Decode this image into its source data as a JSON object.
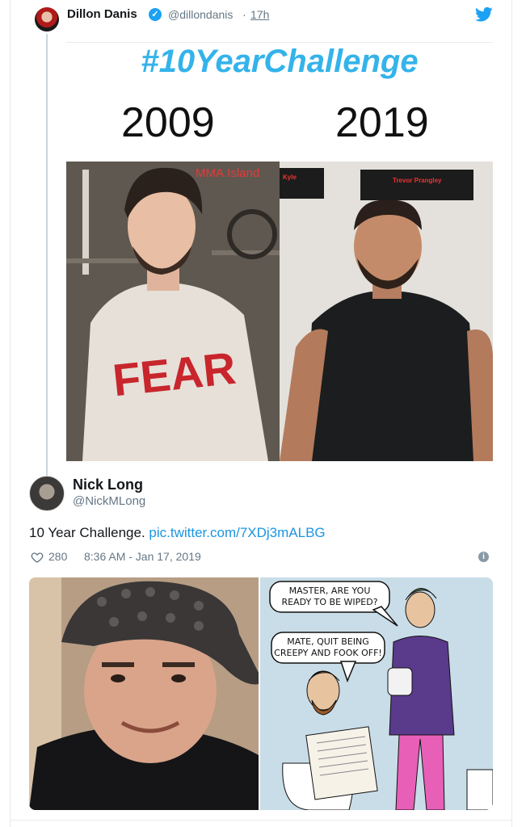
{
  "tweet1": {
    "name": "Dillon Danis",
    "handle": "@dillondanis",
    "separator": "·",
    "time": "17h",
    "image": {
      "title": "#10YearChallenge",
      "year_left": "2009",
      "year_right": "2019",
      "watermark": "MMA.Island",
      "shirt_text": "FEAR",
      "sign_left": "Kyle",
      "sign_right": "Trevor Prangley"
    }
  },
  "tweet2": {
    "name": "Nick Long",
    "handle": "@NickMLong",
    "text": "10 Year Challenge. ",
    "link": "pic.twitter.com/7XDj3mALBG",
    "likes": "280",
    "datetime": "8:36 AM - Jan 17, 2019",
    "cartoon": {
      "bubble1_line1": "MASTER, ARE YOU",
      "bubble1_line2": "READY TO BE WIPED?",
      "bubble2_line1": "MATE, QUIT BEING",
      "bubble2_line2": "CREEPY AND FOOK OFF!"
    }
  },
  "colors": {
    "accent": "#1da1f2",
    "link": "#1b95e0",
    "muted": "#657786",
    "hashtag": "#34b3ea"
  },
  "icons": {
    "verified": "verified-badge-icon",
    "brand": "twitter-bird-icon",
    "like": "heart-icon",
    "info": "info-icon"
  }
}
